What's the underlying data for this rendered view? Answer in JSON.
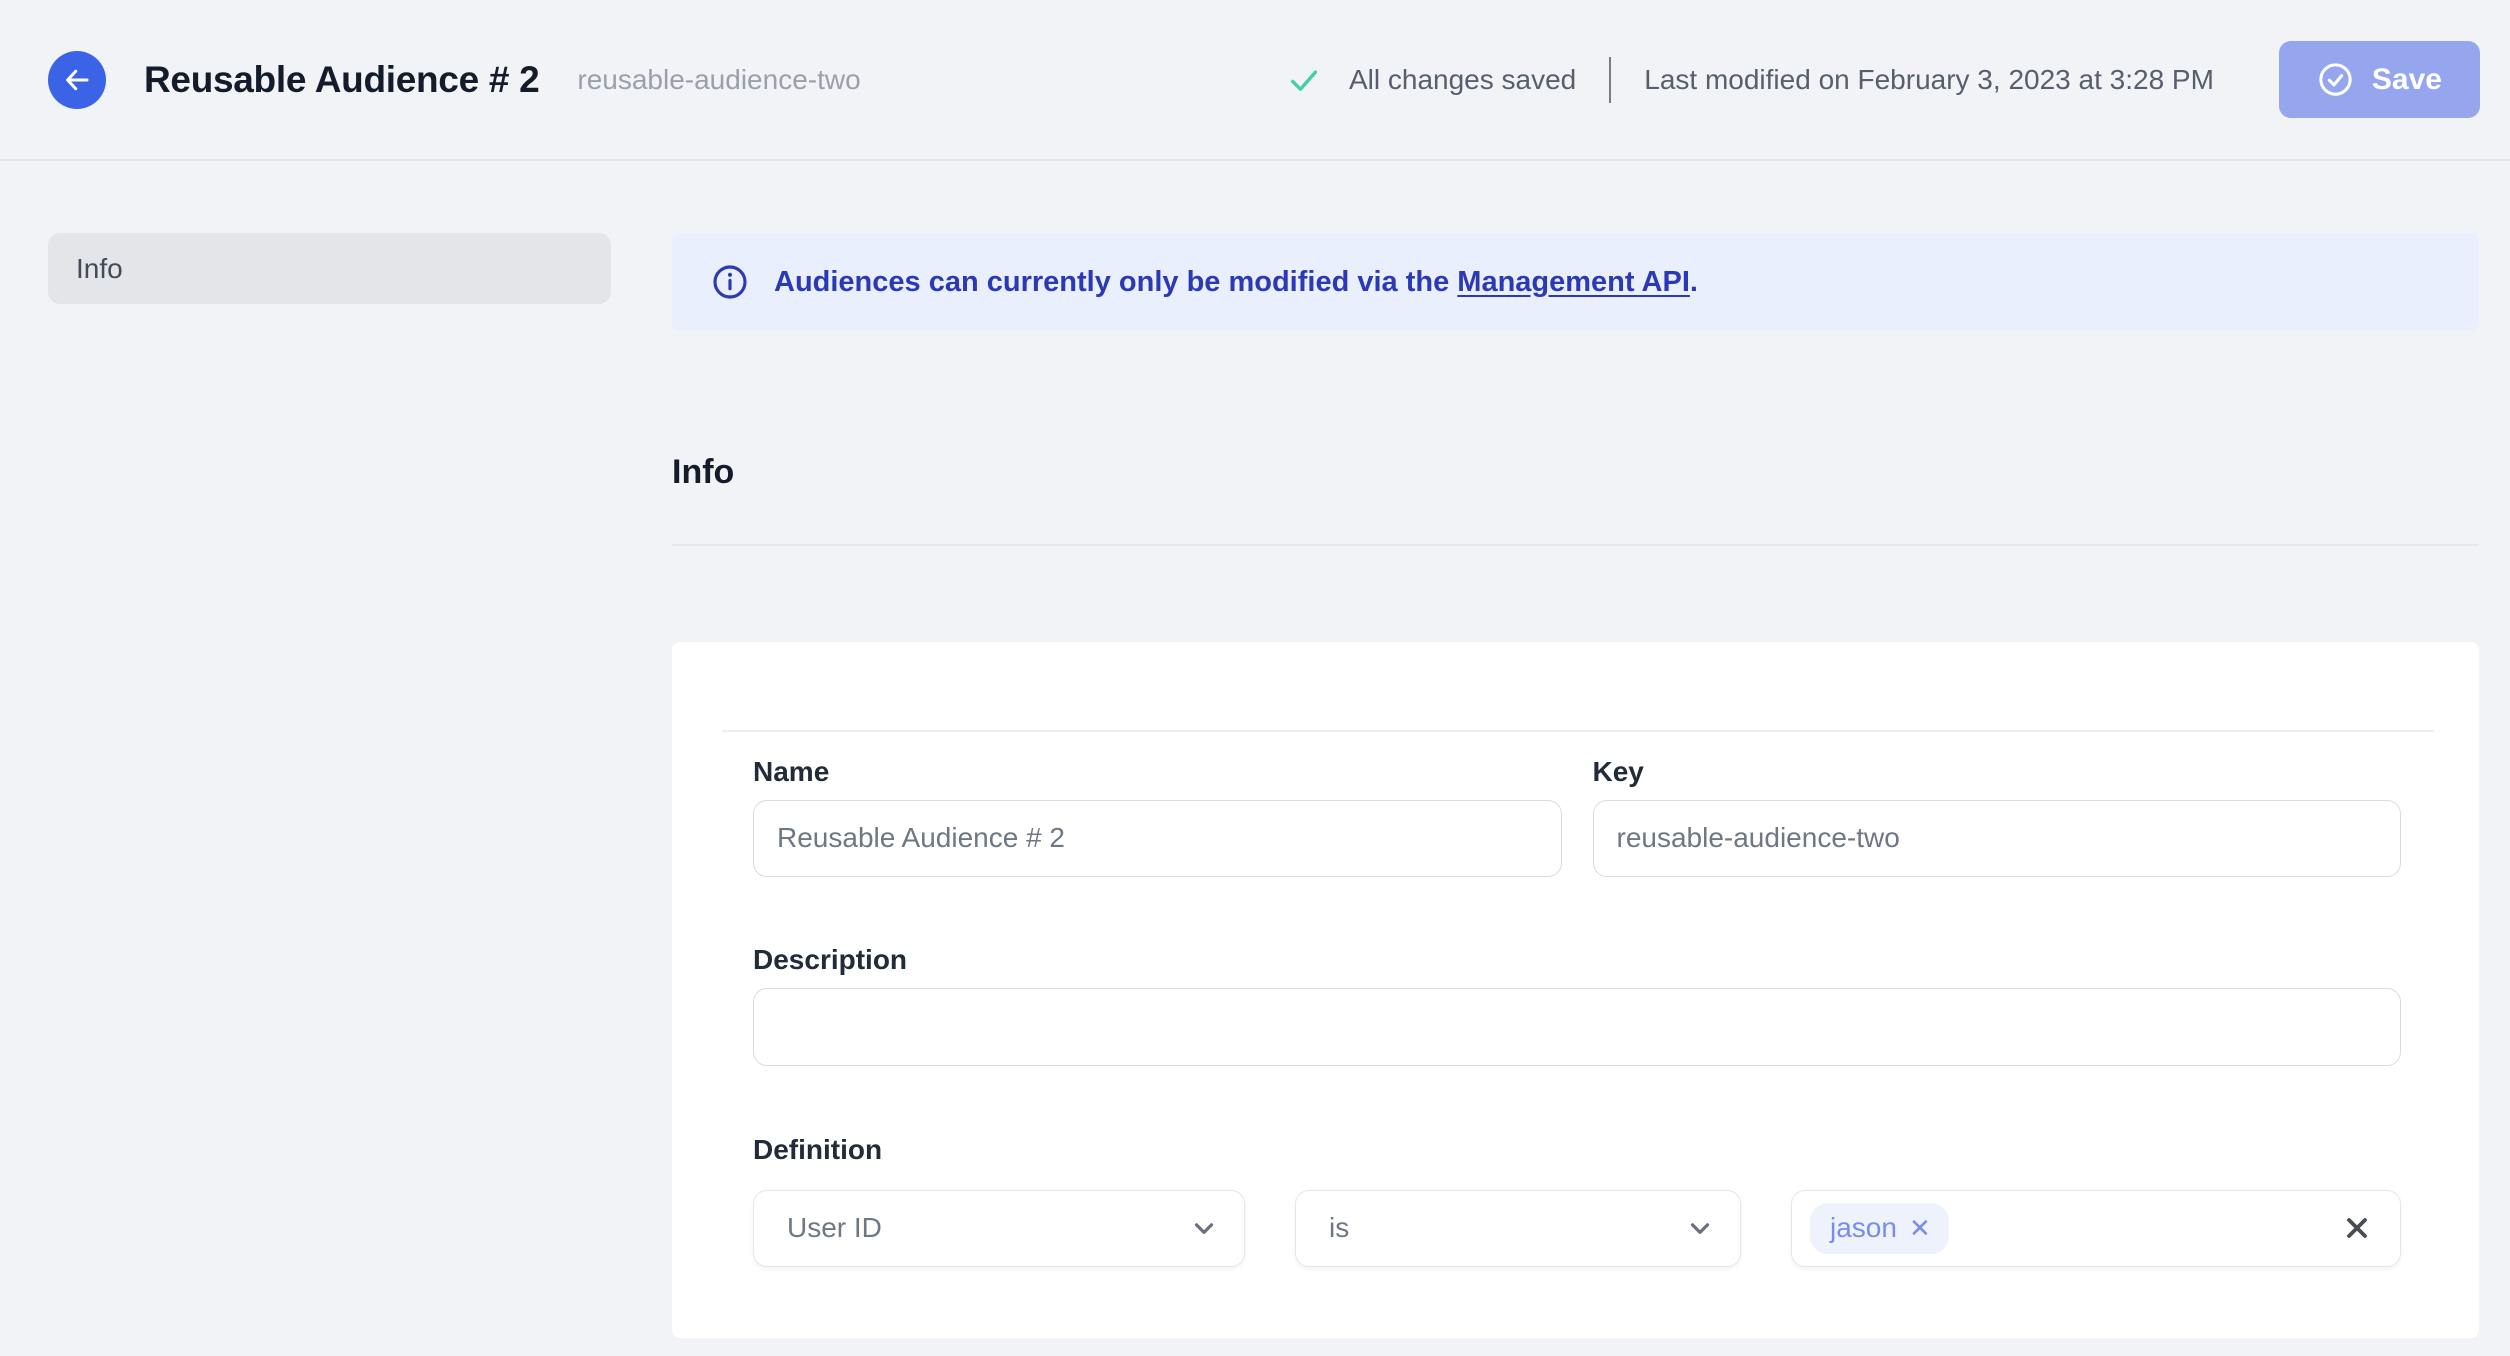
{
  "header": {
    "title": "Reusable Audience # 2",
    "slug": "reusable-audience-two",
    "status_text": "All changes saved",
    "last_modified": "Last modified on February 3, 2023 at 3:28 PM",
    "save_label": "Save"
  },
  "sidebar": {
    "items": [
      {
        "label": "Info",
        "active": true
      }
    ]
  },
  "banner": {
    "text_before_link": "Audiences can currently only be modified via the ",
    "link_text": "Management API",
    "text_after_link": "."
  },
  "main": {
    "section_title": "Info",
    "fields": {
      "name": {
        "label": "Name",
        "value": "Reusable Audience # 2"
      },
      "key": {
        "label": "Key",
        "value": "reusable-audience-two"
      },
      "description": {
        "label": "Description",
        "value": ""
      },
      "definition": {
        "label": "Definition",
        "trait_selected": "User ID",
        "operator_selected": "is",
        "values": [
          "jason"
        ]
      }
    }
  },
  "icons": {
    "back": "arrow-left-icon",
    "saved": "check-icon",
    "save": "circle-check-icon",
    "banner": "info-circle-icon",
    "dropdown": "chevron-down-icon",
    "chip_remove": "x-icon",
    "clear": "x-icon"
  },
  "colors": {
    "page_bg": "#f2f3f6",
    "primary_blue": "#3b63e6",
    "save_button_bg": "#95a5ee",
    "success_green": "#43cfa9",
    "banner_bg": "#e9effc",
    "banner_text": "#2b3ab4",
    "chip_bg": "#edf2fd",
    "chip_text": "#7a8ce9",
    "card_bg": "#ffffff",
    "input_border": "#d8dbe2",
    "input_text": "#6e7784",
    "sidebar_item_bg": "#e4e5e9"
  }
}
